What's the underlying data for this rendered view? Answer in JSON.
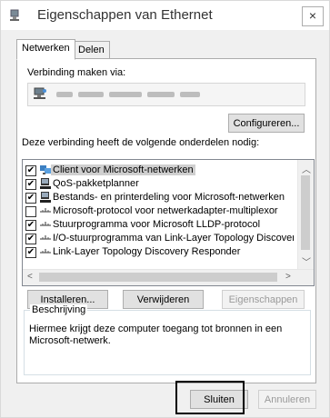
{
  "window": {
    "title": "Eigenschappen van Ethernet",
    "close": "×"
  },
  "tabs": [
    {
      "label": "Netwerken"
    },
    {
      "label": "Delen"
    }
  ],
  "connect_via": {
    "label": "Verbinding maken via:"
  },
  "buttons": {
    "configure": "Configureren...",
    "install": "Installeren...",
    "remove": "Verwijderen",
    "properties": "Eigenschappen",
    "close": "Sluiten",
    "cancel": "Annuleren"
  },
  "components": {
    "label": "Deze verbinding heeft de volgende onderdelen nodig:",
    "items": [
      {
        "label": "Client voor Microsoft-netwerken",
        "checked": true,
        "icon": "network-client-icon"
      },
      {
        "label": "QoS-pakketplanner",
        "checked": true,
        "icon": "service-icon"
      },
      {
        "label": "Bestands- en printerdeling voor Microsoft-netwerken",
        "checked": true,
        "icon": "service-icon"
      },
      {
        "label": "Microsoft-protocol voor netwerkadapter-multiplexor",
        "checked": false,
        "icon": "protocol-icon"
      },
      {
        "label": "Stuurprogramma voor Microsoft LLDP-protocol",
        "checked": true,
        "icon": "protocol-icon"
      },
      {
        "label": "I/O-stuurprogramma van Link-Layer Topology Discover",
        "checked": true,
        "icon": "protocol-icon"
      },
      {
        "label": "Link-Layer Topology Discovery Responder",
        "checked": true,
        "icon": "protocol-icon"
      }
    ]
  },
  "description": {
    "title": "Beschrijving",
    "text": "Hiermee krijgt deze computer toegang tot bronnen in een Microsoft-netwerk."
  }
}
